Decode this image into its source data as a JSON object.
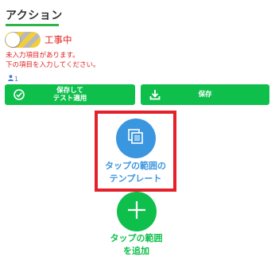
{
  "section": {
    "title": "アクション"
  },
  "toggle": {
    "label": "工事中",
    "on": false
  },
  "warning": {
    "line1": "未入力項目があります。",
    "line2": "下の項目を入力してください。"
  },
  "assignees": {
    "count": "1",
    "icon": "person-icon"
  },
  "buttons": {
    "save_apply": {
      "line1": "保存して",
      "line2": "テスト適用",
      "icon": "check-circle-icon"
    },
    "save": {
      "label": "保存",
      "icon": "download-icon"
    }
  },
  "actions": {
    "template": {
      "line1": "タップの範囲の",
      "line2": "テンプレート",
      "icon": "copy-icon"
    },
    "add": {
      "line1": "タップの範囲",
      "line2": "を追加",
      "icon": "plus-icon"
    }
  },
  "colors": {
    "accent_green": "#0fbf4c",
    "accent_blue": "#3b96e0",
    "warning_red": "#e02020",
    "highlight_red": "#e4202a"
  }
}
